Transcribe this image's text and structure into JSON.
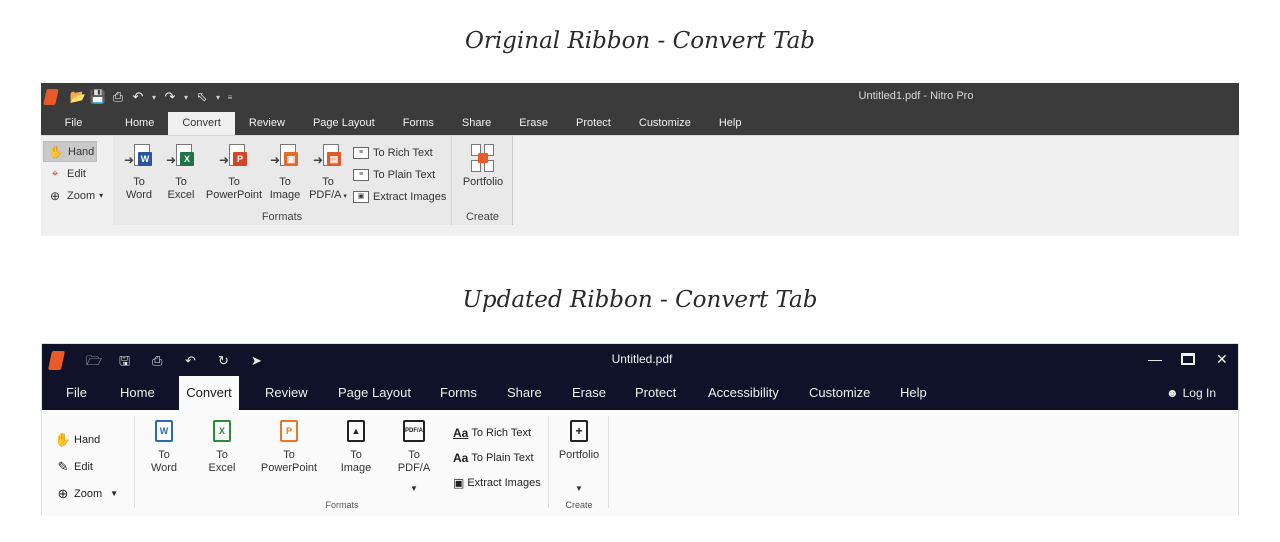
{
  "headings": {
    "original": "Original Ribbon - Convert Tab",
    "updated": "Updated Ribbon - Convert Tab"
  },
  "original": {
    "window_title": "Untitled1.pdf - Nitro Pro",
    "qat_icons": [
      "nitro-logo-icon",
      "open-folder-icon",
      "save-icon",
      "print-icon",
      "undo-icon",
      "redo-icon",
      "select-icon",
      "customize-icon"
    ],
    "tabs": [
      "File",
      "Home",
      "Convert",
      "Review",
      "Page Layout",
      "Forms",
      "Share",
      "Erase",
      "Protect",
      "Customize",
      "Help"
    ],
    "active_tab": "Convert",
    "nav": {
      "hand": "Hand",
      "edit": "Edit",
      "zoom": "Zoom"
    },
    "formats": {
      "to_word": [
        "To",
        "Word"
      ],
      "to_excel": [
        "To",
        "Excel"
      ],
      "to_powerpoint": [
        "To",
        "PowerPoint"
      ],
      "to_image": [
        "To",
        "Image"
      ],
      "to_pdfa": [
        "To",
        "PDF/A"
      ],
      "to_rich_text": "To Rich Text",
      "to_plain_text": "To Plain Text",
      "extract_images": "Extract Images",
      "label": "Formats"
    },
    "create": {
      "portfolio": "Portfolio",
      "label": "Create"
    },
    "badges": {
      "word": "W",
      "excel": "X",
      "powerpoint": "P"
    },
    "colors": {
      "titlebar": "#3b3b3b",
      "word": "#2b579a",
      "excel": "#217346",
      "powerpoint": "#d24726",
      "image": "#e06b2b",
      "pdfa": "#e25a2a"
    }
  },
  "updated": {
    "window_title": "Untitled.pdf",
    "tabs": [
      "File",
      "Home",
      "Convert",
      "Review",
      "Page Layout",
      "Forms",
      "Share",
      "Erase",
      "Protect",
      "Accessibility",
      "Customize",
      "Help"
    ],
    "active_tab": "Convert",
    "login": "Log In",
    "nav": {
      "hand": "Hand",
      "edit": "Edit",
      "zoom": "Zoom"
    },
    "formats": {
      "to_word": [
        "To",
        "Word"
      ],
      "to_excel": [
        "To",
        "Excel"
      ],
      "to_powerpoint": [
        "To",
        "PowerPoint"
      ],
      "to_image": [
        "To",
        "Image"
      ],
      "to_pdfa": [
        "To",
        "PDF/A"
      ],
      "pdfa_icon_text": "PDF/A",
      "aa_glyph": "Aa",
      "to_rich_text": "To Rich Text",
      "to_plain_text": "To Plain Text",
      "extract_images": "Extract Images",
      "label": "Formats"
    },
    "create": {
      "portfolio": "Portfolio",
      "label": "Create"
    },
    "colors": {
      "titlebar": "#0f1229",
      "word": "#2b6cb0",
      "excel": "#2e8b3a",
      "powerpoint": "#e8762c"
    }
  }
}
